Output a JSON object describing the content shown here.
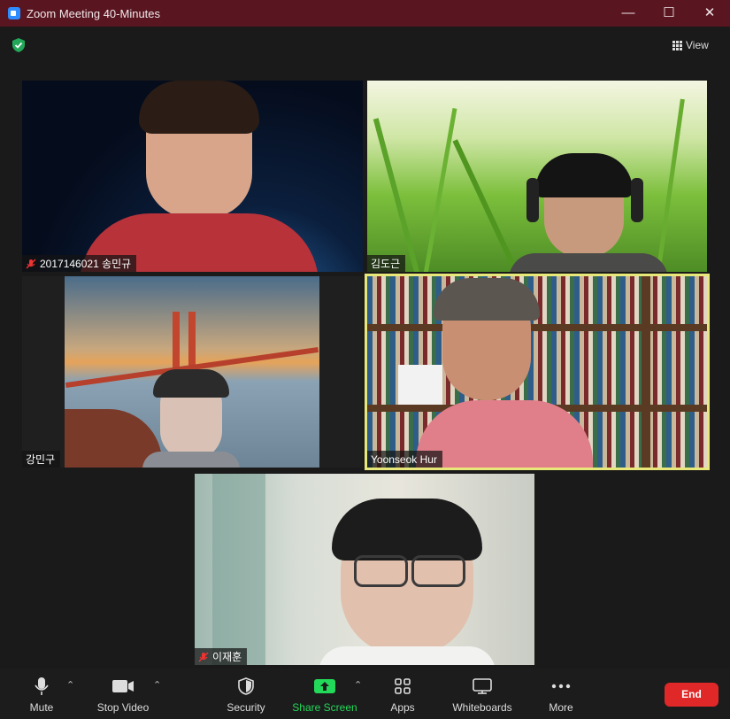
{
  "window": {
    "title": "Zoom Meeting 40-Minutes"
  },
  "top_bar": {
    "view_label": "View"
  },
  "participants": [
    {
      "name": "2017146021 송민규",
      "muted": true
    },
    {
      "name": "김도근",
      "muted": false
    },
    {
      "name": "강민구",
      "muted": false
    },
    {
      "name": "Yoonseok Hur",
      "muted": false,
      "active_speaker": true
    },
    {
      "name": "이재훈",
      "muted": true
    }
  ],
  "toolbar": {
    "mute": "Mute",
    "stop_video": "Stop Video",
    "security": "Security",
    "share_screen": "Share Screen",
    "apps": "Apps",
    "whiteboards": "Whiteboards",
    "more": "More",
    "end": "End"
  },
  "colors": {
    "title_bar": "#5a1620",
    "active_speaker_border": "#e8e87a",
    "share_green": "#23d959",
    "end_red": "#e02828",
    "security_shield": "#23a85a"
  }
}
